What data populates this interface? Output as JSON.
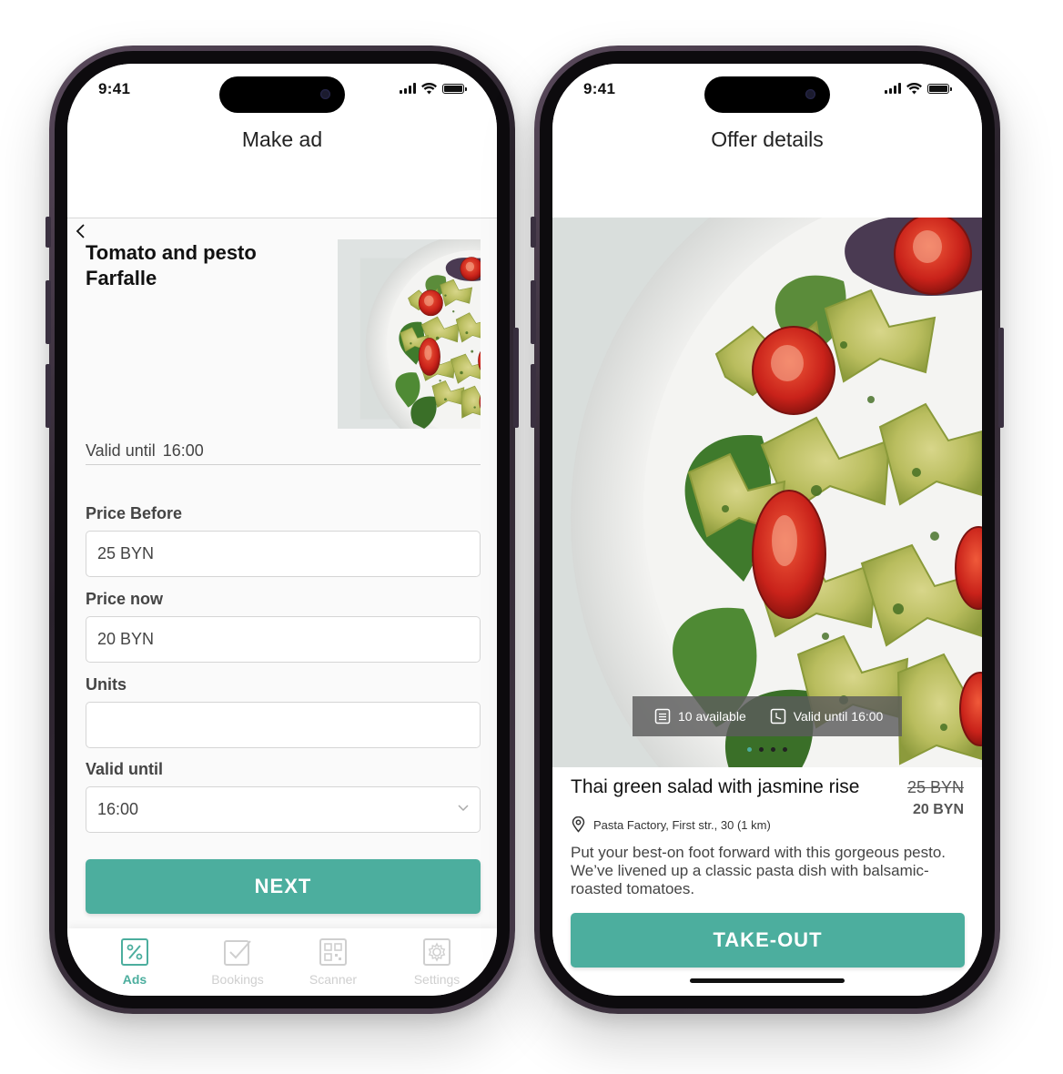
{
  "left_phone": {
    "status": {
      "time": "9:41"
    },
    "nav_title": "Make ad",
    "dish": {
      "title": "Tomato and pesto Farfalle",
      "image": "pesto-farfalle-photo"
    },
    "valid_line": {
      "label": "Valid until",
      "value": "16:00"
    },
    "form": {
      "price_before": {
        "label": "Price Before",
        "value": "25 BYN"
      },
      "price_now": {
        "label": "Price now",
        "value": "20 BYN"
      },
      "units": {
        "label": "Units",
        "value": ""
      },
      "valid_until": {
        "label": "Valid until",
        "value": "16:00"
      }
    },
    "next_label": "NEXT",
    "tabs": [
      {
        "label": "Ads",
        "icon": "percent-icon",
        "active": true
      },
      {
        "label": "Bookings",
        "icon": "checkbox-icon",
        "active": false
      },
      {
        "label": "Scanner",
        "icon": "qr-code-icon",
        "active": false
      },
      {
        "label": "Settings",
        "icon": "gear-icon",
        "active": false
      }
    ]
  },
  "right_phone": {
    "status": {
      "time": "9:41"
    },
    "nav_title": "Offer details",
    "hero": {
      "available": "10 available",
      "valid": "Valid until 16:00",
      "carousel_pages": 4,
      "carousel_active": 1
    },
    "offer": {
      "title": "Thai green salad with jasmine rise",
      "old_price": "25 BYN",
      "new_price": "20 BYN",
      "address": "Pasta Factory, First str., 30 (1 km)",
      "description": "Put your best-on foot forward with this gorgeous pesto. We’ve livened up a classic pasta dish with balsamic-roasted tomatoes."
    },
    "take_out_label": "TAKE-OUT"
  },
  "colors": {
    "accent": "#4cae9e",
    "inactive_tab": "#cfcfcf",
    "frame": "#2b232d"
  }
}
